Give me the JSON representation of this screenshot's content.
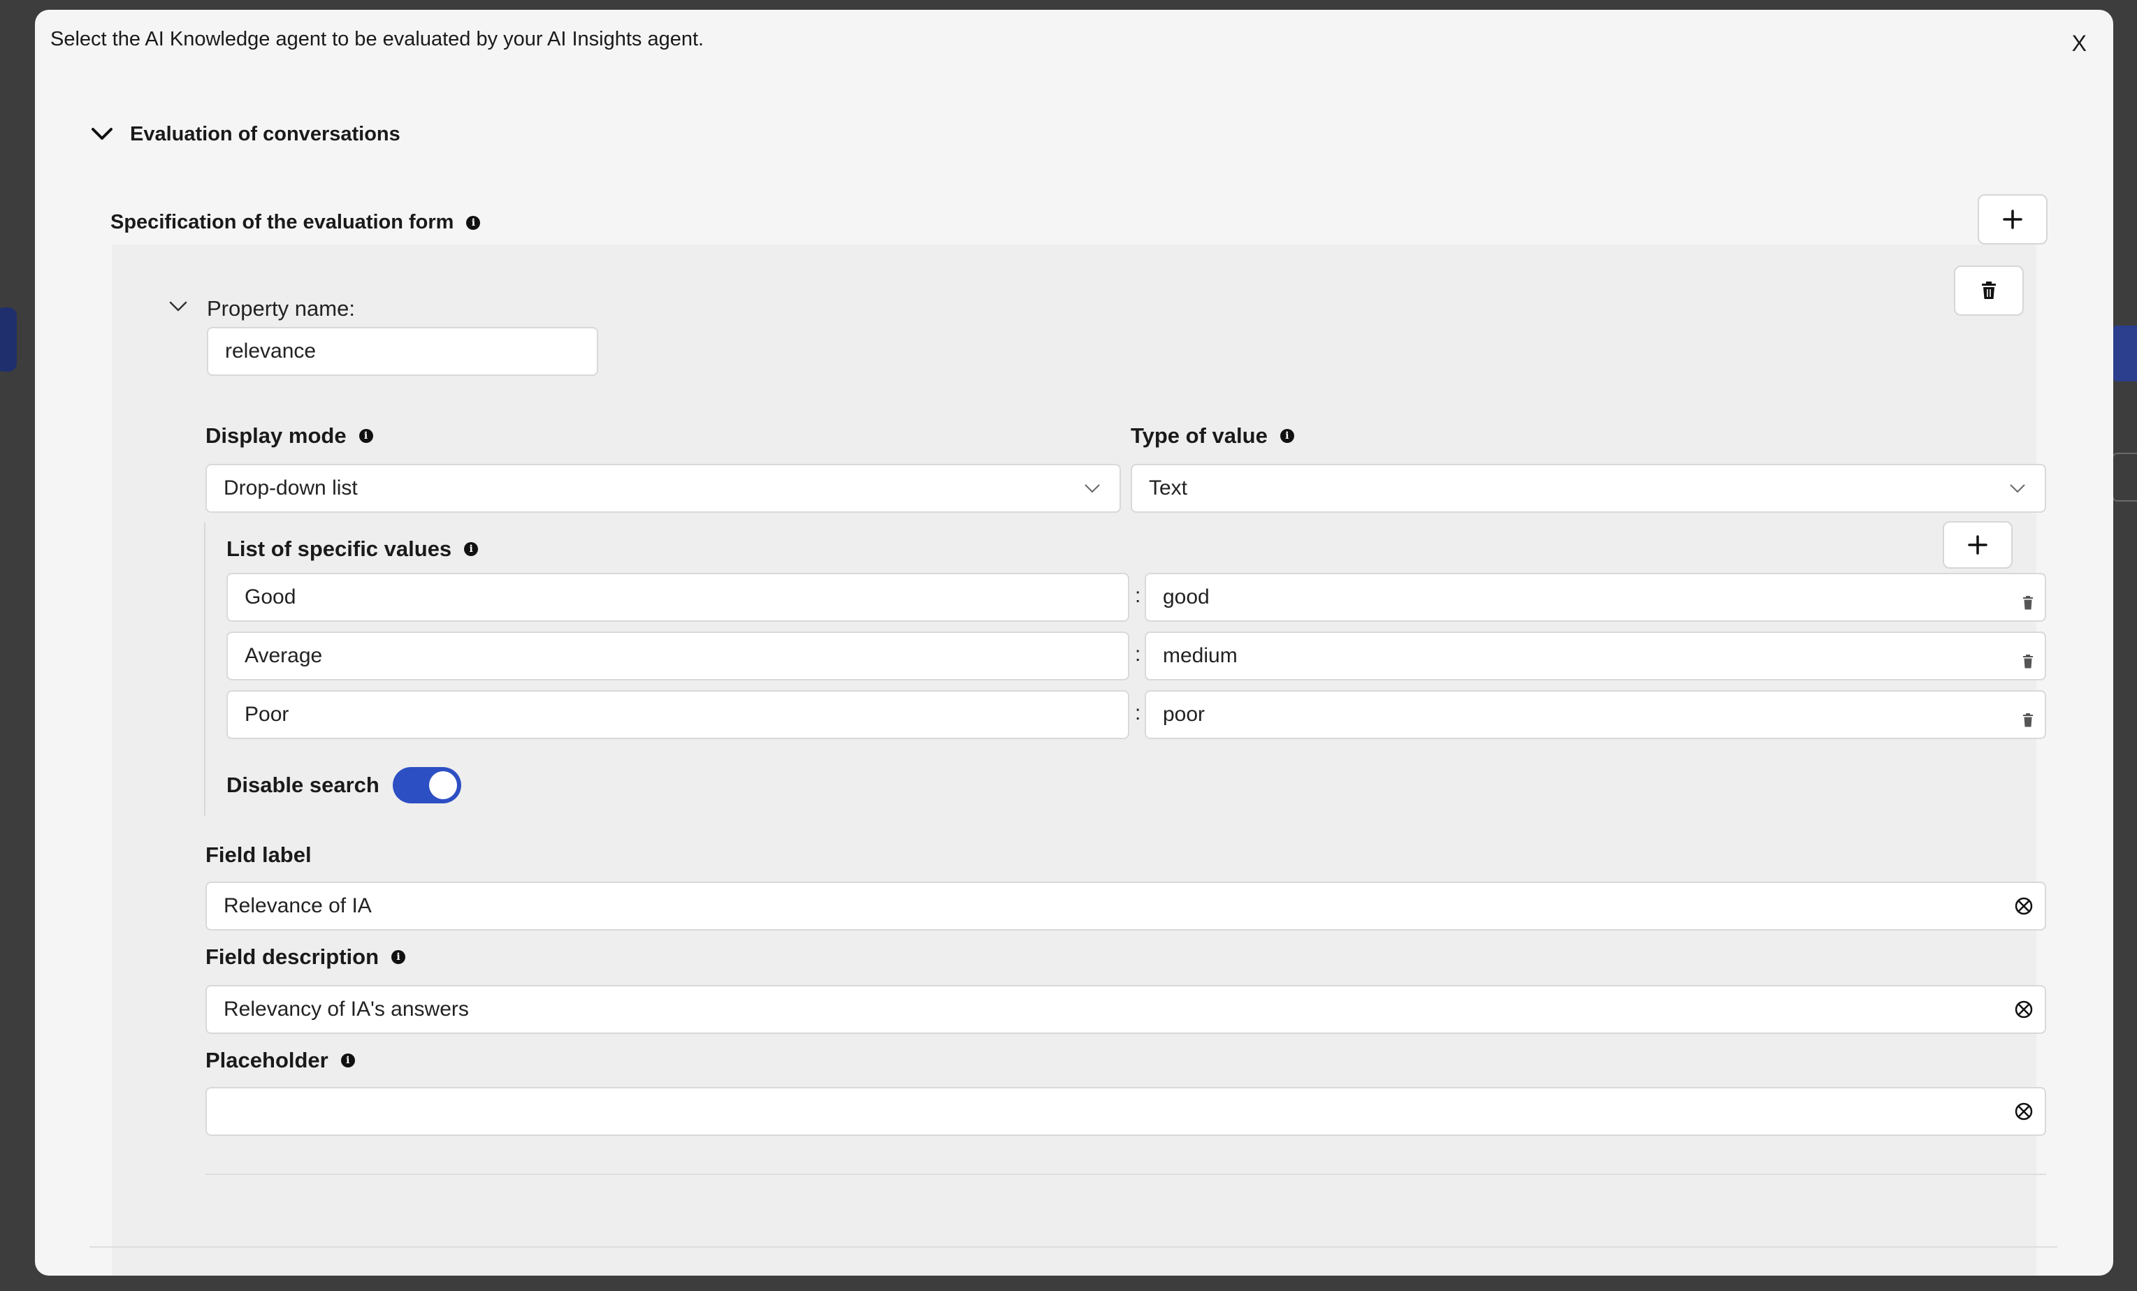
{
  "header": {
    "instruction": "Select the AI Knowledge agent to be evaluated by your AI Insights agent.",
    "close_label": "X"
  },
  "section": {
    "title": "Evaluation of conversations"
  },
  "spec": {
    "title": "Specification of the evaluation form",
    "add_label": "+"
  },
  "property": {
    "name_label": "Property name:",
    "name_value": "relevance",
    "display_mode_label": "Display mode",
    "display_mode_value": "Drop-down list",
    "type_label": "Type of value",
    "type_value": "Text",
    "values_label": "List of specific values",
    "add_value_label": "+",
    "values": [
      {
        "label": "Good",
        "value": "good"
      },
      {
        "label": "Average",
        "value": "medium"
      },
      {
        "label": "Poor",
        "value": "poor"
      }
    ],
    "colon": ":",
    "disable_search_label": "Disable search",
    "disable_search_on": true,
    "field_label_label": "Field label",
    "field_label_value": "Relevance of IA",
    "field_description_label": "Field description",
    "field_description_value": "Relevancy of IA's answers",
    "placeholder_label": "Placeholder",
    "placeholder_value": ""
  },
  "colors": {
    "toggle_on": "#2d4fc4",
    "background_accent": "#1f2f6e"
  }
}
